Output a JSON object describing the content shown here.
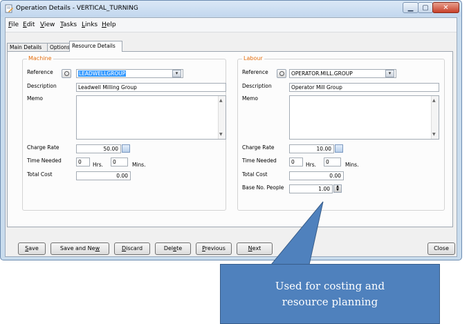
{
  "window": {
    "title": "Operation Details - VERTICAL_TURNING"
  },
  "menu": [
    {
      "key": "F",
      "rest": "ile"
    },
    {
      "key": "E",
      "rest": "dit"
    },
    {
      "key": "V",
      "rest": "iew"
    },
    {
      "key": "T",
      "rest": "asks"
    },
    {
      "key": "L",
      "rest": "inks"
    },
    {
      "key": "H",
      "rest": "elp"
    }
  ],
  "tabs": [
    "Main Details",
    "Options",
    "Resource Details"
  ],
  "machine": {
    "title": "Machine",
    "reference_label": "Reference",
    "reference_value": "LEADWELLGROUP",
    "description_label": "Description",
    "description_value": "Leadwell Milling Group",
    "memo_label": "Memo",
    "charge_rate_label": "Charge Rate",
    "charge_rate_value": "50.00",
    "time_needed_label": "Time Needed",
    "hrs_value": "0",
    "hrs_label": "Hrs.",
    "mins_value": "0",
    "mins_label": "Mins.",
    "total_cost_label": "Total Cost",
    "total_cost_value": "0.00"
  },
  "labour": {
    "title": "Labour",
    "reference_label": "Reference",
    "reference_value": "OPERATOR.MILL.GROUP",
    "description_label": "Description",
    "description_value": "Operator Mill Group",
    "memo_label": "Memo",
    "charge_rate_label": "Charge Rate",
    "charge_rate_value": "10.00",
    "time_needed_label": "Time Needed",
    "hrs_value": "0",
    "hrs_label": "Hrs.",
    "mins_value": "0",
    "mins_label": "Mins.",
    "total_cost_label": "Total Cost",
    "total_cost_value": "0.00",
    "base_people_label": "Base No. People",
    "base_people_value": "1.00"
  },
  "buttons": {
    "save": {
      "key": "S",
      "rest": "ave"
    },
    "save_and_new": {
      "pre": "Save and Ne",
      "key": "w",
      "rest": ""
    },
    "discard": {
      "key": "D",
      "rest": "iscard"
    },
    "delete": {
      "pre": "Del",
      "key": "e",
      "rest": "te"
    },
    "previous": {
      "key": "P",
      "rest": "revious"
    },
    "next": {
      "key": "N",
      "rest": "ext"
    },
    "close": "Close"
  },
  "callout": {
    "line1": "Used for costing and",
    "line2": "resource planning"
  },
  "colors": {
    "group_title": "#e46c0a",
    "callout_fill": "#4f81bd",
    "selection": "#3399ff"
  }
}
